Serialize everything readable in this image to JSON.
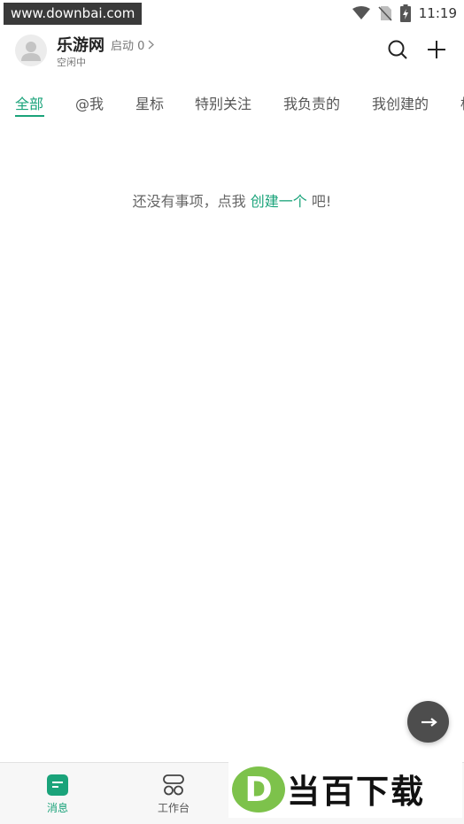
{
  "status_bar": {
    "watermark": "www.downbai.com",
    "time": "11:19",
    "icons": [
      "wifi-icon",
      "no-sim-icon",
      "battery-charging-icon"
    ]
  },
  "header": {
    "org_name": "乐游网",
    "start_label": "启动 0",
    "status": "空闲中",
    "icons": [
      "search-icon",
      "plus-icon"
    ]
  },
  "tabs": [
    {
      "label": "全部",
      "active": true
    },
    {
      "label": "@我"
    },
    {
      "label": "星标"
    },
    {
      "label": "特别关注"
    },
    {
      "label": "我负责的"
    },
    {
      "label": "我创建的"
    },
    {
      "label": "标"
    }
  ],
  "empty_state": {
    "prefix": "还没有事项，点我",
    "link": "创建一个",
    "suffix": "吧!"
  },
  "bottom_nav": [
    {
      "label": "消息",
      "icon": "message-icon",
      "active": true
    },
    {
      "label": "工作台",
      "icon": "workbench-icon"
    }
  ],
  "colors": {
    "accent": "#1aa37a",
    "fab": "#4d4d4d"
  },
  "watermark_logo": {
    "letter": "D",
    "text": "当百下载"
  }
}
